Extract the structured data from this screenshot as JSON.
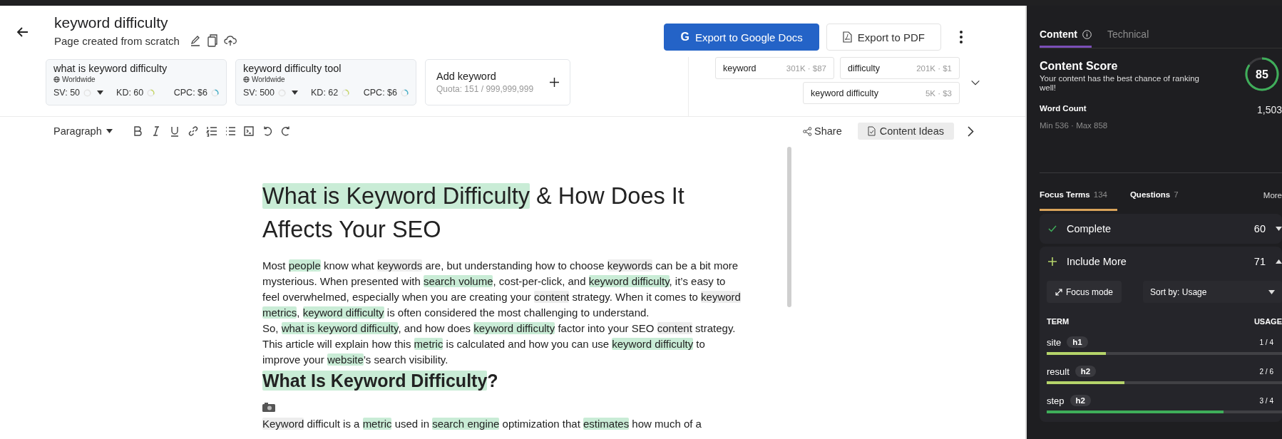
{
  "header": {
    "title": "keyword difficulty",
    "subtitle": "Page created from scratch"
  },
  "keywords": [
    {
      "phrase": "what is keyword difficulty",
      "location": "Worldwide",
      "sv": "SV: 50",
      "kd": "KD: 60",
      "cpc": "CPC: $6"
    },
    {
      "phrase": "keyword difficulty tool",
      "location": "Worldwide",
      "sv": "SV: 500",
      "kd": "KD: 62",
      "cpc": "CPC: $6"
    }
  ],
  "add_keyword": {
    "label": "Add keyword",
    "quota": "Quota: 151 / 999,999,999"
  },
  "actions": [
    {
      "kind": "primary",
      "logo": "G",
      "label": "Export to Google Docs"
    },
    {
      "kind": "secondary",
      "label": "Export to PDF"
    }
  ],
  "term_chips": [
    {
      "term": "keyword",
      "stats": "301K · $87"
    },
    {
      "term": "difficulty",
      "stats": "201K · $1"
    },
    {
      "term": "keyword difficulty",
      "stats": "5K · $3"
    }
  ],
  "toolbar": {
    "block_type": "Paragraph",
    "share": "Share",
    "ideas": "Content Ideas"
  },
  "document": [
    {
      "kind": "h1",
      "segments": [
        {
          "kind": "focus",
          "text": "What is Keyword Difficulty"
        },
        {
          "kind": "plain",
          "text": " & How Does It Affects Your SEO"
        }
      ]
    },
    {
      "kind": "p",
      "segments": [
        {
          "kind": "plain",
          "text": "Most "
        },
        {
          "kind": "focus",
          "text": "people"
        },
        {
          "kind": "plain",
          "text": " know what "
        },
        {
          "kind": "keyword",
          "text": "keywords"
        },
        {
          "kind": "plain",
          "text": " are, but understanding how to choose "
        },
        {
          "kind": "keyword",
          "text": "keywords"
        },
        {
          "kind": "plain",
          "text": " can be a bit more mysterious. When presented with "
        },
        {
          "kind": "focus",
          "text": "search volume"
        },
        {
          "kind": "plain",
          "text": ", cost-per-click, and "
        },
        {
          "kind": "focus",
          "text": "keyword difficulty"
        },
        {
          "kind": "plain",
          "text": ", it’s easy to feel overwhelmed, especially when you are creating your "
        },
        {
          "kind": "keyword",
          "text": "content"
        },
        {
          "kind": "plain",
          "text": " strategy. When it comes to "
        },
        {
          "kind": "keyword",
          "text": "keyword"
        },
        {
          "kind": "focus",
          "text": "metrics",
          "space_before": true
        },
        {
          "kind": "plain",
          "text": ", "
        },
        {
          "kind": "focus",
          "text": "keyword difficulty"
        },
        {
          "kind": "plain",
          "text": " is often considered the most challenging to understand."
        }
      ]
    },
    {
      "kind": "p",
      "segments": [
        {
          "kind": "plain",
          "text": "So, "
        },
        {
          "kind": "focus",
          "text": "what is keyword difficulty"
        },
        {
          "kind": "plain",
          "text": ", and how does "
        },
        {
          "kind": "focus",
          "text": "keyword difficulty"
        },
        {
          "kind": "plain",
          "text": " factor into your SEO "
        },
        {
          "kind": "keyword",
          "text": "content"
        },
        {
          "kind": "plain",
          "text": " strategy. This article will explain how this "
        },
        {
          "kind": "focus",
          "text": "metric"
        },
        {
          "kind": "plain",
          "text": " is calculated and how you can use "
        },
        {
          "kind": "focus",
          "text": "keyword difficulty"
        },
        {
          "kind": "plain",
          "text": " to improve your "
        },
        {
          "kind": "focus",
          "text": "website"
        },
        {
          "kind": "plain",
          "text": "’s search visibility."
        }
      ]
    },
    {
      "kind": "h2",
      "segments": [
        {
          "kind": "focus",
          "text": "What Is Keyword Difficulty"
        },
        {
          "kind": "plain",
          "text": "?"
        }
      ]
    },
    {
      "kind": "image"
    },
    {
      "kind": "p",
      "segments": [
        {
          "kind": "keyword",
          "text": "Keyword"
        },
        {
          "kind": "plain",
          "text": " difficult is a "
        },
        {
          "kind": "focus",
          "text": "metric"
        },
        {
          "kind": "plain",
          "text": " used in "
        },
        {
          "kind": "focus",
          "text": "search engine"
        },
        {
          "kind": "plain",
          "text": " optimization that "
        },
        {
          "kind": "focus",
          "text": "estimates"
        },
        {
          "kind": "plain",
          "text": " how much of a"
        }
      ]
    }
  ],
  "panel": {
    "tabs": [
      {
        "label": "Content",
        "selected": true
      },
      {
        "label": "Technical",
        "selected": false
      }
    ],
    "score": {
      "title": "Content Score",
      "note": "Your content has the best chance of ranking well!",
      "value": "85",
      "level": 0.85
    },
    "word_count": {
      "label": "Word Count",
      "range": "Min 536 · Max 858",
      "value": "1,503"
    },
    "term_tabs": [
      {
        "label": "Focus Terms",
        "count": "134",
        "selected": true
      },
      {
        "label": "Questions",
        "count": "7",
        "selected": false
      }
    ],
    "more": "More",
    "groups": [
      {
        "kind": "complete",
        "label": "Complete",
        "count": "60",
        "expanded": false
      },
      {
        "kind": "include",
        "label": "Include More",
        "count": "71",
        "expanded": true
      }
    ],
    "focus_mode": "Focus mode",
    "sort": "Sort by: Usage",
    "columns": [
      "TERM",
      "USAGE"
    ],
    "rows": [
      {
        "term": "site",
        "tag": "h1",
        "usage": "1 / 4",
        "level": 0.25,
        "color": "#b5d46a"
      },
      {
        "term": "result",
        "tag": "h2",
        "usage": "2 / 6",
        "level": 0.33,
        "color": "#b5d46a"
      },
      {
        "term": "step",
        "tag": "h2",
        "usage": "3 / 4",
        "level": 0.75,
        "color": "#3fae5a"
      }
    ]
  }
}
